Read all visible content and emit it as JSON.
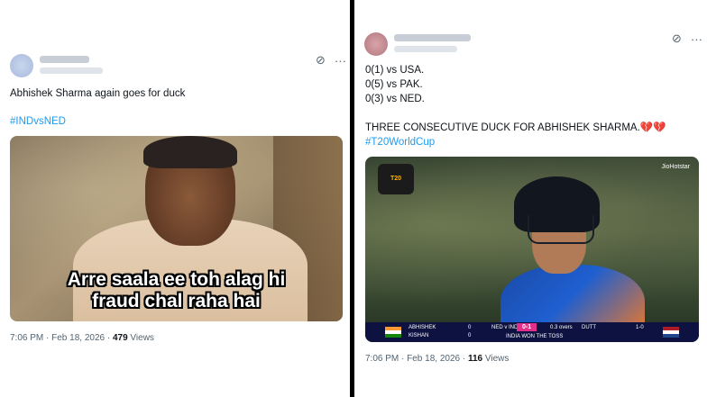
{
  "left_post": {
    "text": "Abhishek Sharma again goes for duck",
    "hashtag": "#INDvsNED",
    "image": {
      "caption_line1": "Arre saala ee toh alag hi",
      "caption_line2": "fraud chal raha hai"
    },
    "time": "7:06 PM · Feb 18, 2026 ·",
    "views_count": "479",
    "views_label": "Views"
  },
  "right_post": {
    "lines": [
      "0(1) vs USA.",
      "0(5) vs PAK.",
      "0(3) vs NED."
    ],
    "headline": "THREE CONSECUTIVE DUCK FOR ABHISHEK SHARMA.💔💔",
    "hashtag": "#T20WorldCup",
    "image": {
      "logo_text": "T20",
      "broadcaster": "JioHotstar",
      "scoreboard": {
        "batter1": "ABHISHEK",
        "batter2": "KISHAN",
        "batter1_score": "0",
        "batter2_score": "0",
        "match": "NED v IND",
        "score": "0-1",
        "overs": "0.3 overs",
        "toss": "INDIA WON THE TOSS",
        "bowler": "DUTT",
        "bowler_figures": "1-0"
      }
    },
    "time": "7:06 PM · Feb 18, 2026 ·",
    "views_count": "116",
    "views_label": "Views"
  },
  "icons": [
    "grok-icon",
    "more-icon"
  ],
  "colors": {
    "link": "#1d9bf0",
    "divider": "#000000",
    "meta": "#536471"
  }
}
